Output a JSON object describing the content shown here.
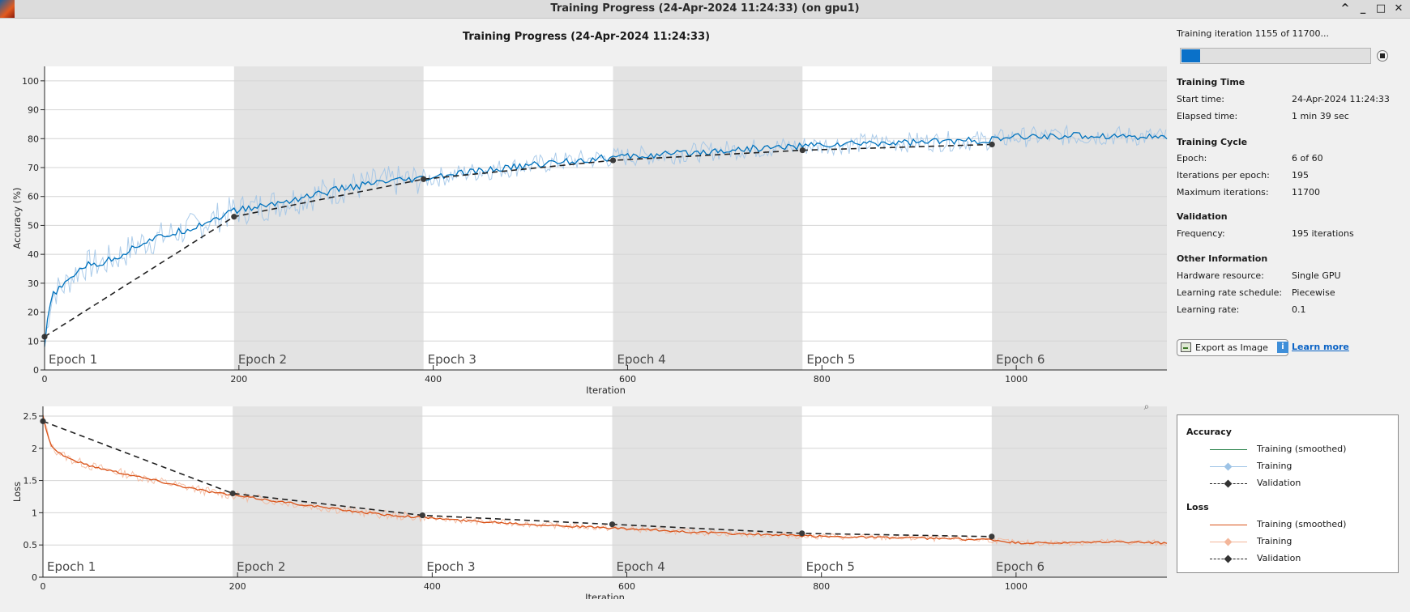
{
  "window": {
    "title": "Training Progress (24-Apr-2024 11:24:33) (on gpu1)",
    "controls": [
      "^",
      "_",
      "□",
      "✕"
    ]
  },
  "plot_title": "Training Progress (24-Apr-2024 11:24:33)",
  "status": {
    "text": "Training iteration 1155 of 11700...",
    "progress_fraction": 0.0987
  },
  "training_time": {
    "heading": "Training Time",
    "rows": [
      {
        "label": "Start time:",
        "value": "24-Apr-2024 11:24:33"
      },
      {
        "label": "Elapsed time:",
        "value": "1 min 39 sec"
      }
    ]
  },
  "training_cycle": {
    "heading": "Training Cycle",
    "rows": [
      {
        "label": "Epoch:",
        "value": "6 of 60"
      },
      {
        "label": "Iterations per epoch:",
        "value": "195"
      },
      {
        "label": "Maximum iterations:",
        "value": "11700"
      }
    ]
  },
  "validation": {
    "heading": "Validation",
    "rows": [
      {
        "label": "Frequency:",
        "value": "195 iterations"
      }
    ]
  },
  "other_info": {
    "heading": "Other Information",
    "rows": [
      {
        "label": "Hardware resource:",
        "value": "Single GPU"
      },
      {
        "label": "Learning rate schedule:",
        "value": "Piecewise"
      },
      {
        "label": "Learning rate:",
        "value": "0.1"
      }
    ]
  },
  "buttons": {
    "export": "Export as Image",
    "learn_more": "Learn more"
  },
  "legend": {
    "accuracy_heading": "Accuracy",
    "loss_heading": "Loss",
    "items": [
      "Training (smoothed)",
      "Training",
      "Validation"
    ]
  },
  "colors": {
    "acc_smoothed": "#0072bd",
    "acc_raw": "#9dc3e6",
    "loss_smoothed": "#d95319",
    "loss_raw": "#f3b69a",
    "validation": "#222222",
    "legend_acc_smoothed": "#1b7a3f",
    "epoch_band": "#e3e3e3"
  },
  "chart_data": [
    {
      "type": "line",
      "ylabel": "Accuracy (%)",
      "xlabel": "Iteration",
      "xlim": [
        0,
        1155
      ],
      "ylim": [
        0,
        105
      ],
      "xticks": [
        0,
        200,
        400,
        600,
        800,
        1000
      ],
      "yticks": [
        0,
        10,
        20,
        30,
        40,
        50,
        60,
        70,
        80,
        90,
        100
      ],
      "epoch_labels": [
        "Epoch 1",
        "Epoch 2",
        "Epoch 3",
        "Epoch 4",
        "Epoch 5",
        "Epoch 6"
      ],
      "epoch_boundaries": [
        0,
        195,
        390,
        585,
        780,
        975,
        1155
      ],
      "smoothed": {
        "x": [
          0,
          5,
          10,
          20,
          30,
          40,
          60,
          80,
          100,
          120,
          150,
          180,
          195,
          230,
          270,
          310,
          350,
          390,
          430,
          480,
          530,
          585,
          640,
          700,
          780,
          850,
          920,
          975,
          1000,
          1050,
          1100,
          1155
        ],
        "y": [
          8,
          22,
          27,
          29,
          33,
          36,
          37,
          40,
          44,
          46,
          49,
          53,
          55,
          57,
          60,
          63,
          65,
          66,
          68,
          70,
          72,
          73.5,
          74.5,
          76,
          77.5,
          78.5,
          79,
          79.5,
          80.5,
          81,
          81,
          80.5
        ]
      },
      "validation": {
        "x": [
          0,
          195,
          390,
          585,
          780,
          975
        ],
        "y": [
          11.5,
          53,
          66,
          72.5,
          76,
          78
        ]
      }
    },
    {
      "type": "line",
      "ylabel": "Loss",
      "xlabel": "Iteration",
      "xlim": [
        0,
        1155
      ],
      "ylim": [
        0,
        2.65
      ],
      "xticks": [
        0,
        200,
        400,
        600,
        800,
        1000
      ],
      "yticks": [
        0,
        0.5,
        1,
        1.5,
        2,
        2.5
      ],
      "ytick_labels": [
        "0",
        "0.5",
        "1",
        "1.5",
        "2",
        "2.5"
      ],
      "epoch_labels": [
        "Epoch 1",
        "Epoch 2",
        "Epoch 3",
        "Epoch 4",
        "Epoch 5",
        "Epoch 6"
      ],
      "epoch_boundaries": [
        0,
        195,
        390,
        585,
        780,
        975,
        1155
      ],
      "smoothed": {
        "x": [
          0,
          5,
          10,
          20,
          30,
          50,
          80,
          110,
          140,
          170,
          195,
          230,
          270,
          310,
          350,
          390,
          430,
          480,
          530,
          585,
          640,
          700,
          780,
          850,
          920,
          975,
          1000,
          1050,
          1100,
          1155
        ],
        "y": [
          2.5,
          2.2,
          2.0,
          1.9,
          1.82,
          1.72,
          1.62,
          1.52,
          1.42,
          1.33,
          1.27,
          1.2,
          1.12,
          1.04,
          0.97,
          0.93,
          0.88,
          0.84,
          0.8,
          0.76,
          0.72,
          0.68,
          0.64,
          0.62,
          0.6,
          0.58,
          0.53,
          0.53,
          0.55,
          0.53
        ]
      },
      "validation": {
        "x": [
          0,
          195,
          390,
          585,
          780,
          975
        ],
        "y": [
          2.42,
          1.3,
          0.96,
          0.82,
          0.68,
          0.63
        ]
      }
    }
  ]
}
